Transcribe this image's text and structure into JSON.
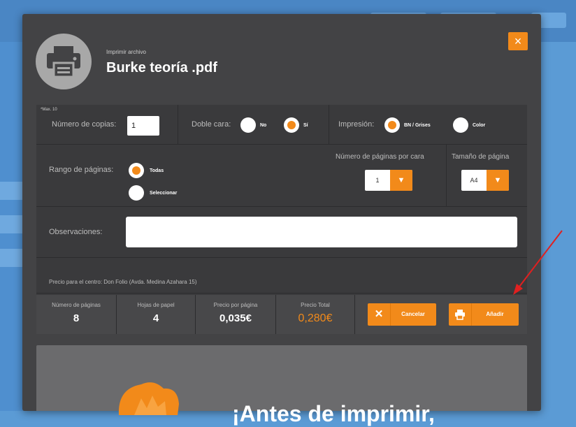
{
  "dialog": {
    "subtitle": "Imprimir archivo",
    "filename": "Burke teoría .pdf",
    "close_symbol": "×"
  },
  "options": {
    "max_note": "*Max. 10",
    "copies_label": "Número de copias:",
    "copies_value": "1",
    "duplex_label": "Doble cara:",
    "duplex_no": "No",
    "duplex_yes": "Sí",
    "duplex_selected": "Sí",
    "print_label": "Impresión:",
    "print_bw": "BN / Grises",
    "print_color": "Color",
    "print_selected": "BN / Grises"
  },
  "range": {
    "label": "Rango de páginas:",
    "all": "Todas",
    "select": "Seleccionar",
    "selected": "Todas",
    "pages_per_side_label": "Número de páginas por cara",
    "pages_per_side_value": "1",
    "page_size_label": "Tamaño de página",
    "page_size_value": "A4"
  },
  "observations": {
    "label": "Observaciones:",
    "value": ""
  },
  "price_center": "Precio para el centro: Don Folio (Avda. Medina Azahara 15)",
  "stats": [
    {
      "title": "Número de páginas",
      "value": "8"
    },
    {
      "title": "Hojas de papel",
      "value": "4"
    },
    {
      "title": "Precio por página",
      "value": "0,035€"
    },
    {
      "title": "Precio Total",
      "value": "0,280€"
    }
  ],
  "buttons": {
    "cancel": "Cancelar",
    "add": "Añadir"
  },
  "banner": {
    "text": "¡Antes de imprimir,"
  },
  "colors": {
    "accent": "#f28a1a",
    "modal": "#434345",
    "panel": "#3a3a3c",
    "annotation_arrow": "#e02020"
  },
  "icons": [
    "printer-icon",
    "close-icon",
    "chevron-down-icon",
    "x-icon",
    "print-icon"
  ]
}
